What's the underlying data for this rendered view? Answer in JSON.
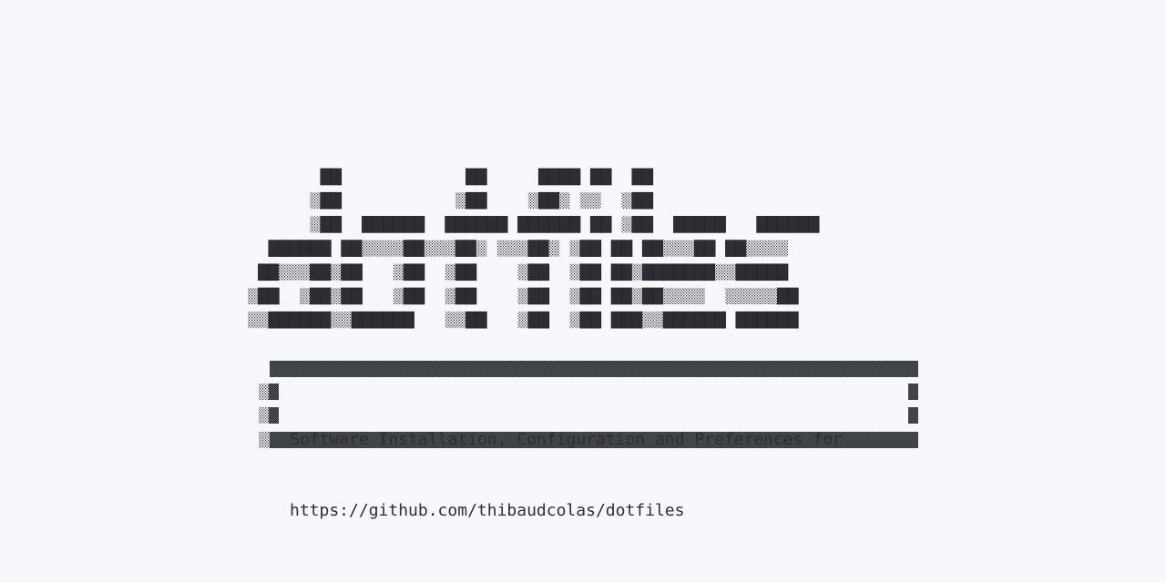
{
  "logo": {
    "text": "dotfiles",
    "colors": {
      "solid": "#2b2f33",
      "cell_border": "#1b1e21",
      "background": "#f6f8fa"
    }
  },
  "banner": {
    "line1": "Software Installation, Configuration and Preferences for",
    "line2": "https://github.com/thibaudcolas/dotfiles"
  }
}
